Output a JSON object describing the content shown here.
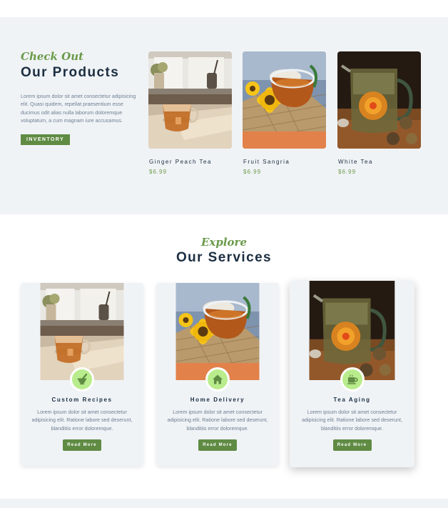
{
  "products_section": {
    "eyebrow": "Check Out",
    "title": "Our Products",
    "description": "Lorem ipsum dolor sit amet consectetur adipisicing elit. Quasi quidem, repellat praesentium esse ducimus odit alias nulla laborum doloremque voluptatum, a cum magnam iure accusamus.",
    "button_label": "INVENTORY",
    "items": [
      {
        "name": "Ginger Peach Tea",
        "price": "$6.99",
        "image": "tea-cup-on-windowsill"
      },
      {
        "name": "Fruit Sangria",
        "price": "$6.99",
        "image": "tea-cup-with-sunflowers"
      },
      {
        "name": "White Tea",
        "price": "$6.99",
        "image": "glass-teapot-blooming-tea"
      }
    ]
  },
  "services_section": {
    "eyebrow": "Explore",
    "title": "Our Services",
    "cards": [
      {
        "title": "Custom Recipes",
        "icon": "mortar-pestle-icon",
        "text": "Lorem ipsum dolor sit amet consectetur adipisicing elit. Ratione labore sed deserunt, blanditiis error doloremque.",
        "button_label": "Read More"
      },
      {
        "title": "Home Delivery",
        "icon": "home-icon",
        "text": "Lorem ipsum dolor sit amet consectetur adipisicing elit. Ratione labore sed deserunt, blanditiis error doloremque.",
        "button_label": "Read More"
      },
      {
        "title": "Tea Aging",
        "icon": "mug-icon",
        "text": "Lorem ipsum dolor sit amet consectetur adipisicing elit. Ratione labore sed deserunt, blanditiis error doloremque.",
        "button_label": "Read More"
      }
    ]
  },
  "colors": {
    "accent_green": "#5f8b43",
    "eyebrow_green": "#6a9a4a",
    "icon_circle": "#b9ec8c",
    "heading_navy": "#1b2e42",
    "section_bg": "#f0f3f6"
  }
}
